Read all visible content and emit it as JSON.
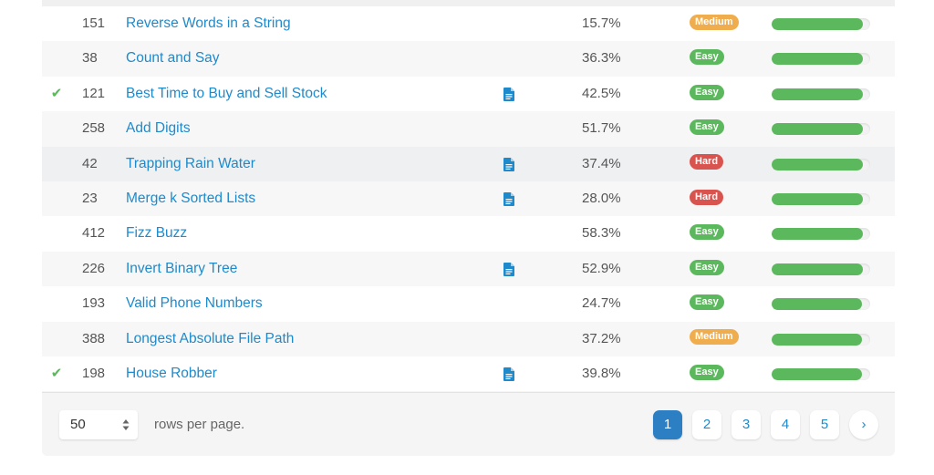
{
  "rows": [
    {
      "solved": false,
      "id": "151",
      "title": "Reverse Words in a String",
      "has_solution": false,
      "acceptance": "15.7%",
      "difficulty": "Medium",
      "frequency": 0.93
    },
    {
      "solved": false,
      "id": "38",
      "title": "Count and Say",
      "has_solution": false,
      "acceptance": "36.3%",
      "difficulty": "Easy",
      "frequency": 0.93
    },
    {
      "solved": true,
      "id": "121",
      "title": "Best Time to Buy and Sell Stock",
      "has_solution": true,
      "acceptance": "42.5%",
      "difficulty": "Easy",
      "frequency": 0.93
    },
    {
      "solved": false,
      "id": "258",
      "title": "Add Digits",
      "has_solution": false,
      "acceptance": "51.7%",
      "difficulty": "Easy",
      "frequency": 0.93
    },
    {
      "solved": false,
      "id": "42",
      "title": "Trapping Rain Water",
      "has_solution": true,
      "acceptance": "37.4%",
      "difficulty": "Hard",
      "frequency": 0.93
    },
    {
      "solved": false,
      "id": "23",
      "title": "Merge k Sorted Lists",
      "has_solution": true,
      "acceptance": "28.0%",
      "difficulty": "Hard",
      "frequency": 0.93
    },
    {
      "solved": false,
      "id": "412",
      "title": "Fizz Buzz",
      "has_solution": false,
      "acceptance": "58.3%",
      "difficulty": "Easy",
      "frequency": 0.93
    },
    {
      "solved": false,
      "id": "226",
      "title": "Invert Binary Tree",
      "has_solution": true,
      "acceptance": "52.9%",
      "difficulty": "Easy",
      "frequency": 0.93
    },
    {
      "solved": false,
      "id": "193",
      "title": "Valid Phone Numbers",
      "has_solution": false,
      "acceptance": "24.7%",
      "difficulty": "Easy",
      "frequency": 0.92
    },
    {
      "solved": false,
      "id": "388",
      "title": "Longest Absolute File Path",
      "has_solution": false,
      "acceptance": "37.2%",
      "difficulty": "Medium",
      "frequency": 0.92
    },
    {
      "solved": true,
      "id": "198",
      "title": "House Robber",
      "has_solution": true,
      "acceptance": "39.8%",
      "difficulty": "Easy",
      "frequency": 0.92
    }
  ],
  "hover_row_index": 4,
  "icons": {
    "solved": "check-icon",
    "solution": "document-icon",
    "select_arrows": "sort-arrows-icon",
    "next": "chevron-right-icon"
  },
  "check_glyph": "✔",
  "colors": {
    "link": "#1f8acb",
    "easy": "#5cb85c",
    "medium": "#f0ad4e",
    "hard": "#d9534f",
    "active_page": "#2c7fc3",
    "progress": "#5cb85c"
  },
  "footer": {
    "rows_per_page_value": "50",
    "rows_per_page_label": "rows per page.",
    "pages": [
      "1",
      "2",
      "3",
      "4",
      "5"
    ],
    "active_page": "1",
    "next_glyph": "›"
  }
}
